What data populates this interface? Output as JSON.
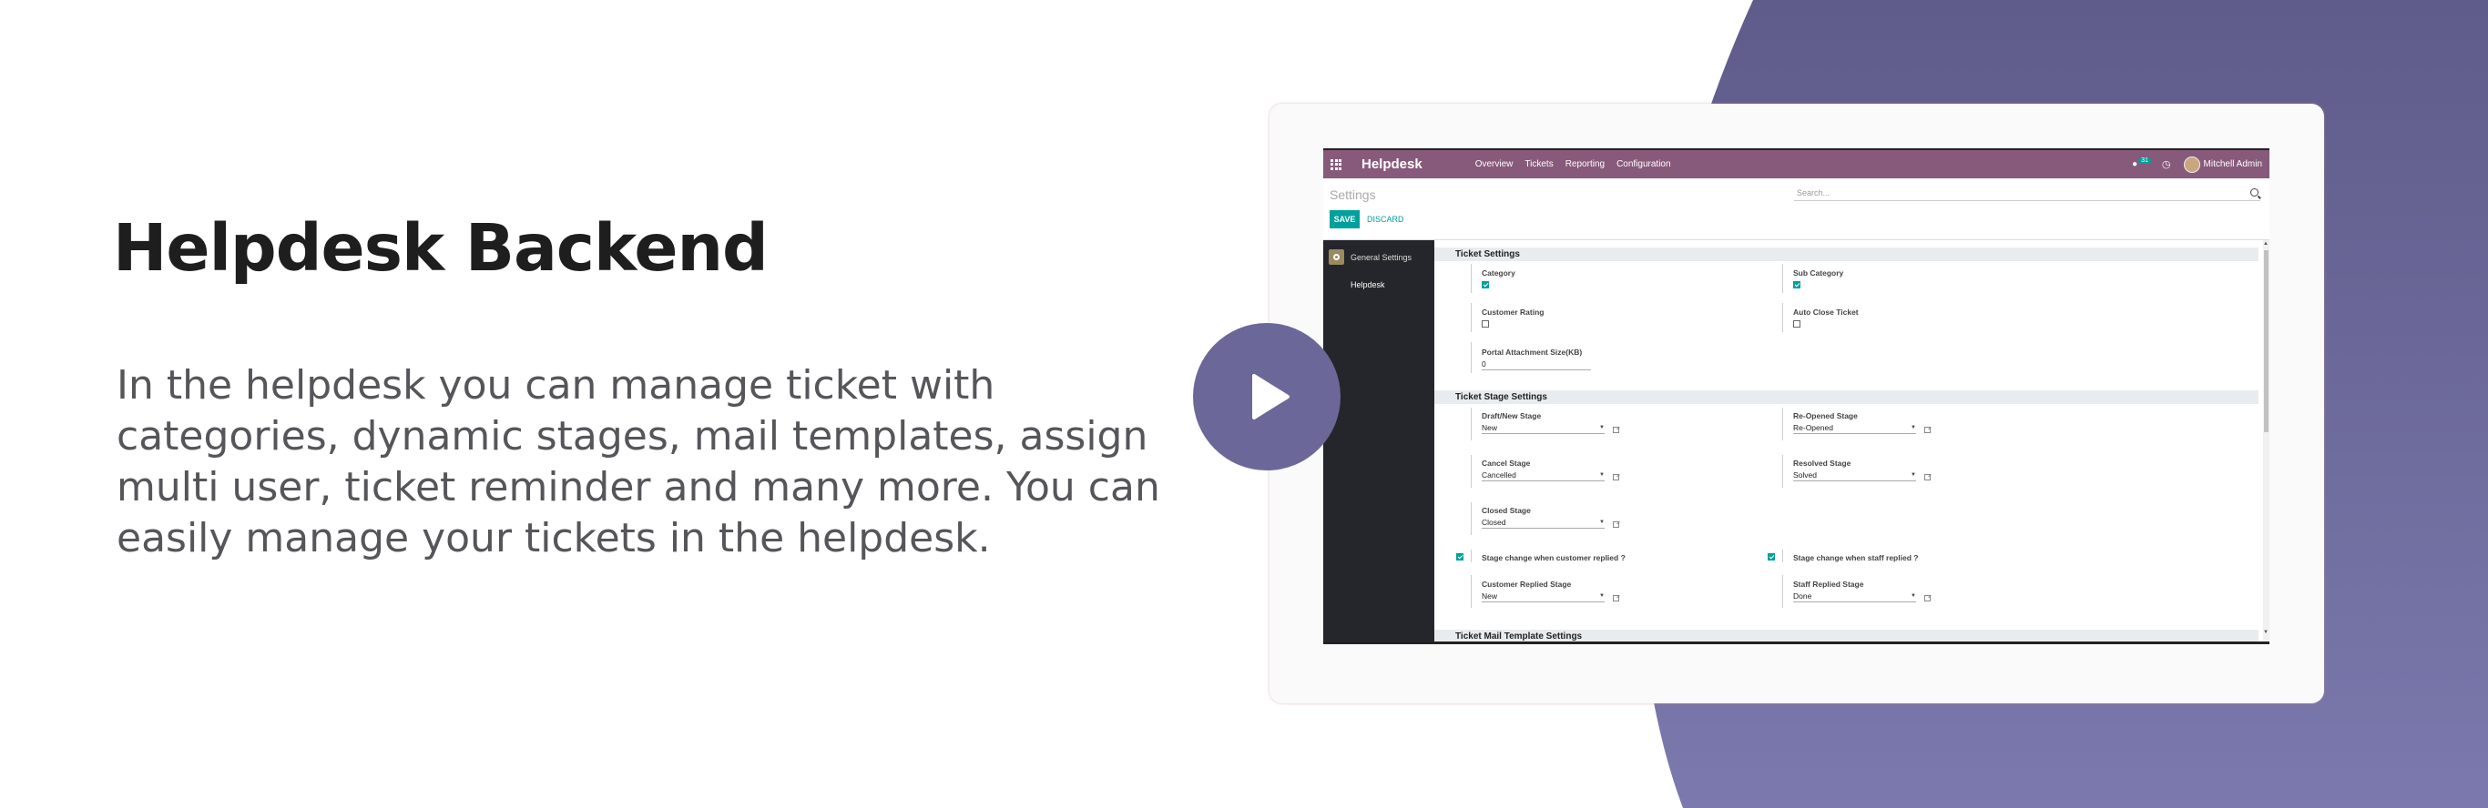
{
  "hero": {
    "title": "Helpdesk Backend",
    "description": "In the helpdesk you can manage ticket with categories, dynamic stages, mail templates, assign multi user, ticket reminder and many more. You can easily manage your tickets in the helpdesk."
  },
  "colors": {
    "accent": "#6b6899",
    "odoo_purple": "#875a7b",
    "teal": "#00a09d",
    "sidebar": "#25262b"
  },
  "app": {
    "name": "Helpdesk",
    "menu": [
      "Overview",
      "Tickets",
      "Reporting",
      "Configuration"
    ],
    "chat_count": "31",
    "user": "Mitchell Admin"
  },
  "control_panel": {
    "title": "Settings",
    "search_placeholder": "Search...",
    "save": "SAVE",
    "discard": "DISCARD"
  },
  "sidebar": {
    "general": "General Settings",
    "module": "Helpdesk"
  },
  "ticket_settings": {
    "title": "Ticket Settings",
    "category": "Category",
    "sub_category": "Sub Category",
    "customer_rating": "Customer Rating",
    "auto_close": "Auto Close Ticket",
    "attachment_label": "Portal Attachment Size(KB)",
    "attachment_value": "0"
  },
  "stage_settings": {
    "title": "Ticket Stage Settings",
    "draft_label": "Draft/New Stage",
    "draft_value": "New",
    "reopened_label": "Re-Opened Stage",
    "reopened_value": "Re-Opened",
    "cancel_label": "Cancel Stage",
    "cancel_value": "Cancelled",
    "resolved_label": "Resolved Stage",
    "resolved_value": "Solved",
    "closed_label": "Closed Stage",
    "closed_value": "Closed",
    "cust_replied_toggle": "Stage change when customer replied ?",
    "staff_replied_toggle": "Stage change when staff replied ?",
    "cust_replied_label": "Customer Replied Stage",
    "cust_replied_value": "New",
    "staff_replied_label": "Staff Replied Stage",
    "staff_replied_value": "Done"
  },
  "mail_settings": {
    "title": "Ticket Mail Template Settings"
  }
}
